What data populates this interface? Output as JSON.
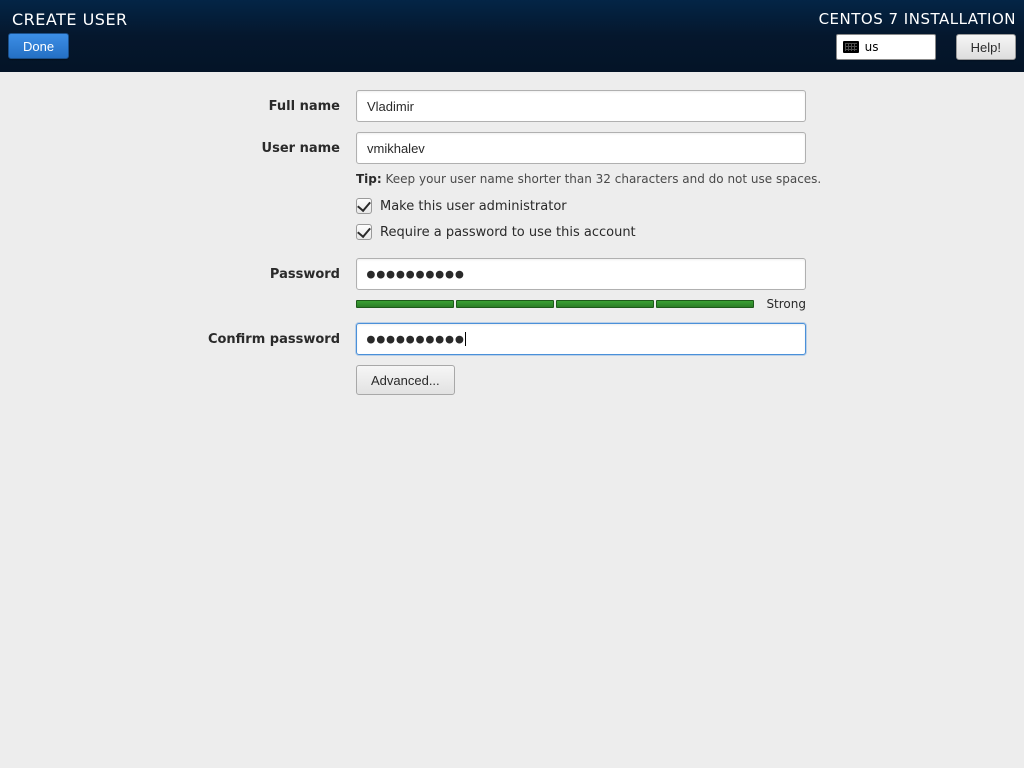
{
  "header": {
    "title": "CREATE USER",
    "install_title": "CENTOS 7 INSTALLATION",
    "done_label": "Done",
    "keyboard_layout": "us",
    "help_label": "Help!"
  },
  "form": {
    "fullname_label": "Full name",
    "fullname_value": "Vladimir",
    "username_label": "User name",
    "username_value": "vmikhalev",
    "tip_prefix": "Tip:",
    "tip_text": "Keep your user name shorter than 32 characters and do not use spaces.",
    "admin_checkbox_label": "Make this user administrator",
    "admin_checked": true,
    "require_pw_label": "Require a password to use this account",
    "require_pw_checked": true,
    "password_label": "Password",
    "password_mask": "●●●●●●●●●●",
    "strength_label": "Strong",
    "confirm_label": "Confirm password",
    "confirm_mask": "●●●●●●●●●●",
    "advanced_label": "Advanced..."
  }
}
